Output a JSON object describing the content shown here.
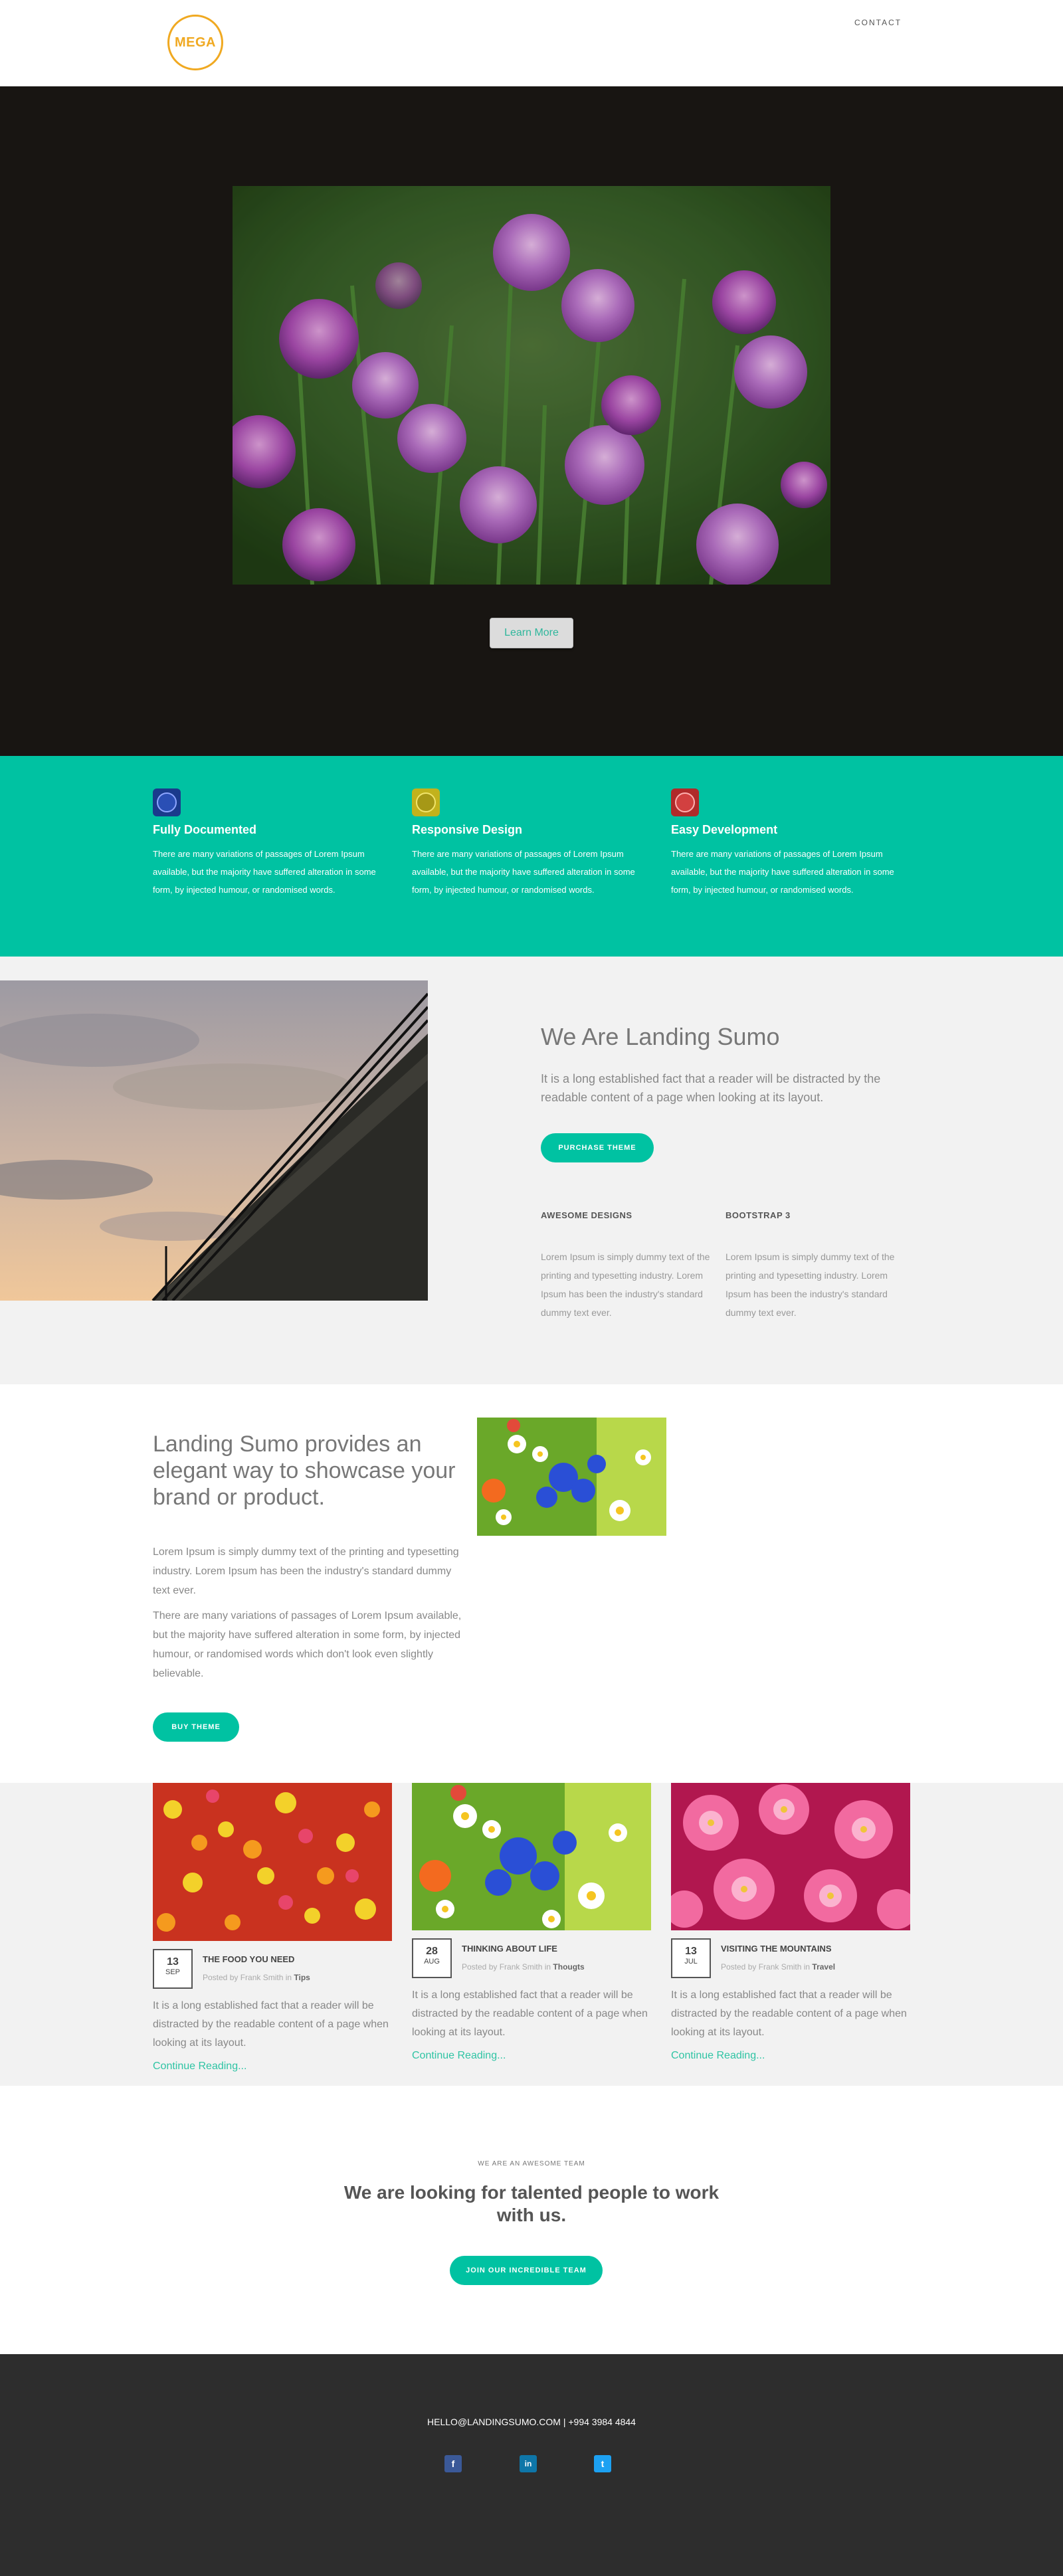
{
  "header": {
    "logo_text": "MEGA",
    "nav_contact": "CONTACT"
  },
  "hero": {
    "image_desc": "purple flowers",
    "button_label": "Learn More"
  },
  "features": [
    {
      "title": "Fully Documented",
      "text": "There are many variations of passages of Lorem Ipsum available, but the majority have suffered alteration in some form, by injected humour, or randomised words.",
      "icon": "documented-icon",
      "icon_color": "#1a3a8c"
    },
    {
      "title": "Responsive Design",
      "text": "There are many variations of passages of Lorem Ipsum available, but the majority have suffered alteration in some form, by injected humour, or randomised words.",
      "icon": "responsive-icon",
      "icon_color": "#c2b21c"
    },
    {
      "title": "Easy Development",
      "text": "There are many variations of passages of Lorem Ipsum available, but the majority have suffered alteration in some form, by injected humour, or randomised words.",
      "icon": "development-icon",
      "icon_color": "#b02a2a"
    }
  ],
  "about": {
    "title": "We Are Landing Sumo",
    "lead": "It is a long established fact that a reader will be distracted by the readable content of a page when looking at its layout.",
    "button_label": "PURCHASE THEME",
    "columns": [
      {
        "title": "AWESOME DESIGNS",
        "text": "Lorem Ipsum is simply dummy text of the printing and typesetting industry. Lorem Ipsum has been the industry's standard dummy text ever."
      },
      {
        "title": "BOOTSTRAP 3",
        "text": "Lorem Ipsum is simply dummy text of the printing and typesetting industry. Lorem Ipsum has been the industry's standard dummy text ever."
      }
    ]
  },
  "showcase": {
    "title": "Landing Sumo provides an elegant way to showcase your brand or product.",
    "paragraph1": "Lorem Ipsum is simply dummy text of the printing and typesetting industry. Lorem Ipsum has been the industry's standard dummy text ever.",
    "paragraph2": "There are many variations of passages of Lorem Ipsum available, but the majority have suffered alteration in some form, by injected humour, or randomised words which don't look even slightly believable.",
    "button_label": "BUY THEME"
  },
  "posts": [
    {
      "day": "13",
      "month": "SEP",
      "title": "THE FOOD YOU NEED",
      "meta_prefix": "Posted by Frank Smith in",
      "category": "Tips",
      "excerpt": "It is a long established fact that a reader will be distracted by the readable content of a page when looking at its layout.",
      "more": "Continue Reading..."
    },
    {
      "day": "28",
      "month": "AUG",
      "title": "THINKING ABOUT LIFE",
      "meta_prefix": "Posted by Frank Smith in",
      "category": "Thougts",
      "excerpt": "It is a long established fact that a reader will be distracted by the readable content of a page when looking at its layout.",
      "more": "Continue Reading..."
    },
    {
      "day": "13",
      "month": "JUL",
      "title": "VISITING THE MOUNTAINS",
      "meta_prefix": "Posted by Frank Smith in",
      "category": "Travel",
      "excerpt": "It is a long established fact that a reader will be distracted by the readable content of a page when looking at its layout.",
      "more": "Continue Reading..."
    }
  ],
  "team": {
    "eyebrow": "WE ARE AN AWESOME TEAM",
    "title": "We are looking for talented people to work with us.",
    "button_label": "JOIN OUR INCREDIBLE TEAM"
  },
  "footer": {
    "contact": "HELLO@LANDINGSUMO.COM | +994 3984 4844",
    "social": [
      {
        "name": "facebook-icon",
        "glyph": "f",
        "color": "#3b5998"
      },
      {
        "name": "linkedin-icon",
        "glyph": "in",
        "color": "#0e76a8"
      },
      {
        "name": "twitter-icon",
        "glyph": "t",
        "color": "#1da1f2"
      }
    ]
  },
  "colors": {
    "accent": "#00c2a2",
    "logo": "#f0a921",
    "hero_bg": "#181512",
    "footer_bg": "#2d2d2d"
  }
}
